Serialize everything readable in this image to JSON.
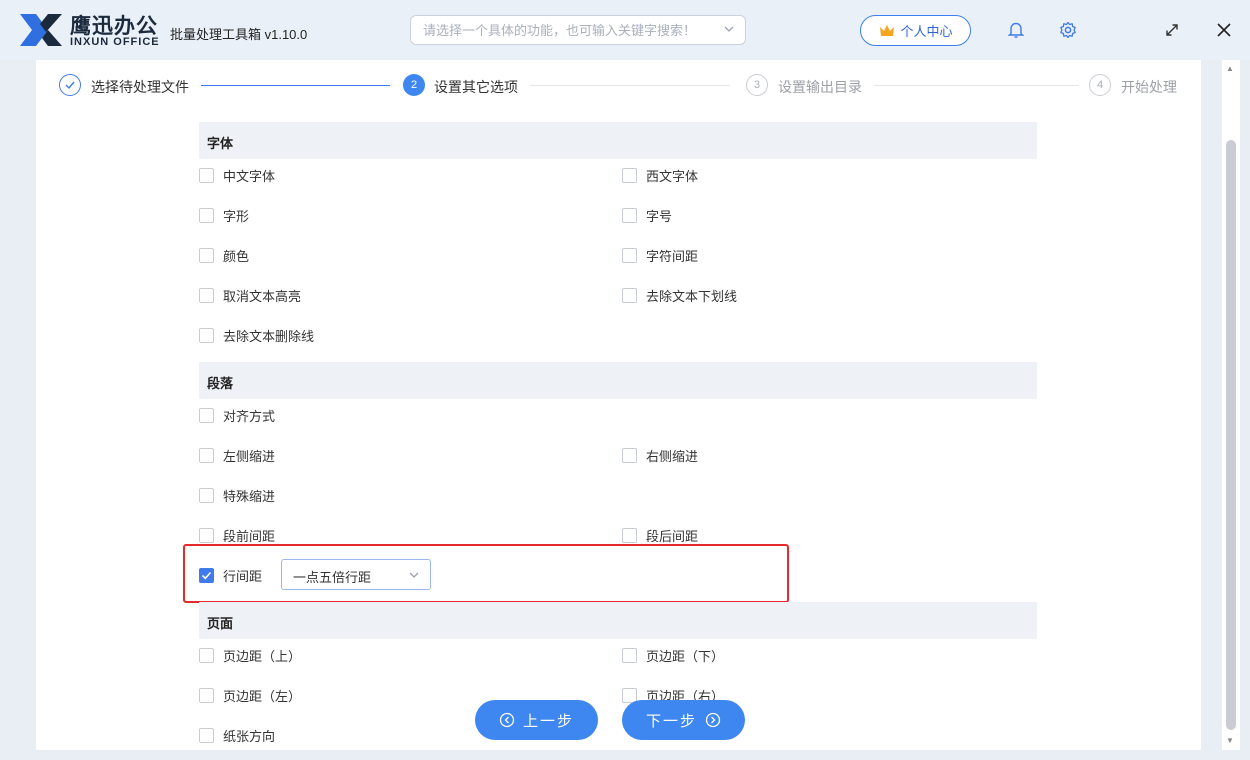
{
  "app": {
    "logo_cn": "鹰迅办公",
    "logo_en": "INXUN OFFICE",
    "title": "批量处理工具箱 v1.10.0"
  },
  "search": {
    "placeholder": "请选择一个具体的功能，也可输入关键字搜索！"
  },
  "header": {
    "user_center": "个人中心",
    "icons": [
      "crown-icon",
      "bell-icon",
      "gear-icon",
      "maximize-icon",
      "close-icon"
    ]
  },
  "colors": {
    "accent": "#3f87f0",
    "highlight_border": "#e42a2a",
    "section_bg": "#eef1f6"
  },
  "steps": [
    {
      "num": "",
      "label": "选择待处理文件",
      "state": "done"
    },
    {
      "num": "2",
      "label": "设置其它选项",
      "state": "active"
    },
    {
      "num": "3",
      "label": "设置输出目录",
      "state": "pending"
    },
    {
      "num": "4",
      "label": "开始处理",
      "state": "pending"
    }
  ],
  "sections": {
    "font": {
      "title": "字体",
      "options": [
        "中文字体",
        "西文字体",
        "字形",
        "字号",
        "颜色",
        "字符间距",
        "取消文本高亮",
        "去除文本下划线",
        "去除文本删除线"
      ]
    },
    "paragraph": {
      "title": "段落",
      "options": [
        "对齐方式",
        "左侧缩进",
        "右侧缩进",
        "特殊缩进",
        "段前间距",
        "段后间距",
        "行间距"
      ],
      "line_spacing_checked": true,
      "line_spacing_value": "一点五倍行距"
    },
    "page": {
      "title": "页面",
      "options": [
        "页边距（上）",
        "页边距（下）",
        "页边距（左）",
        "页边距（右）",
        "纸张方向"
      ]
    }
  },
  "nav": {
    "prev": "上一步",
    "next": "下一步"
  }
}
